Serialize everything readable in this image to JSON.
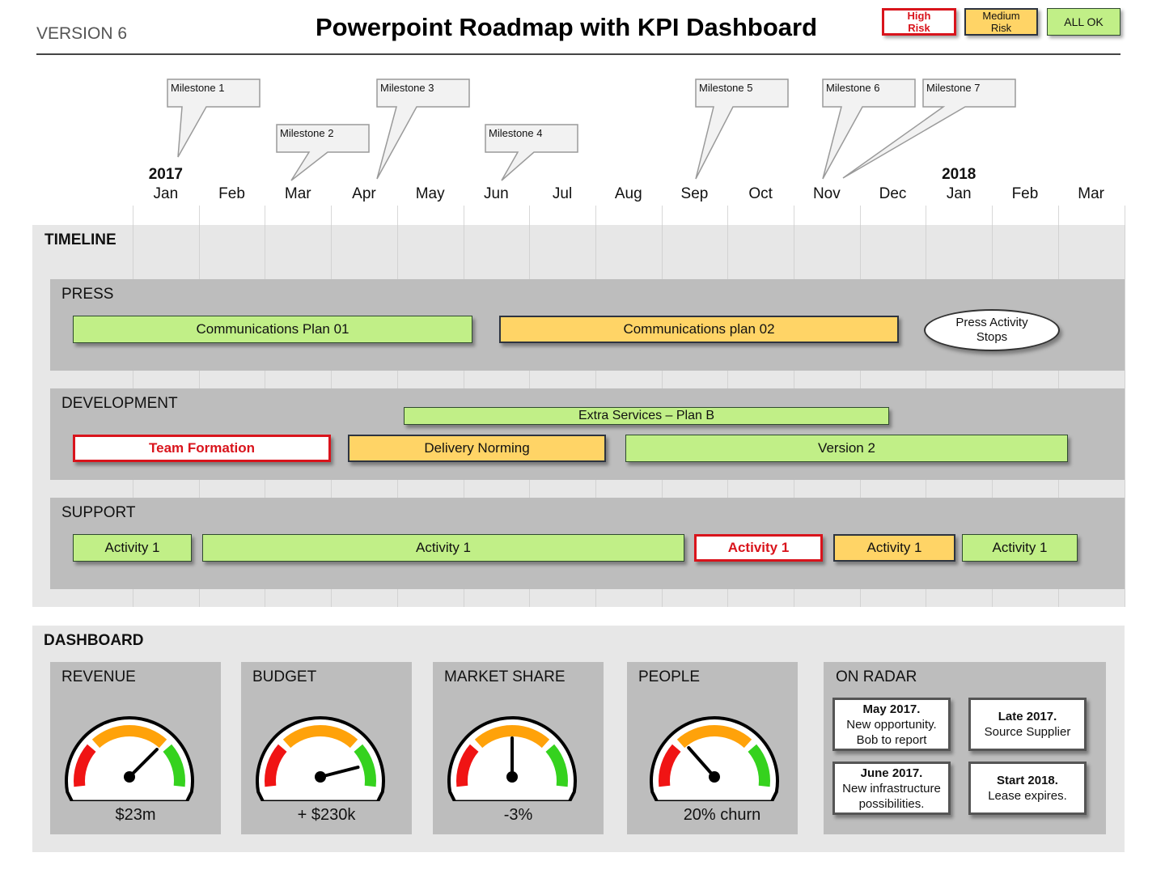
{
  "header": {
    "version": "VERSION 6",
    "title": "Powerpoint Roadmap with KPI Dashboard",
    "legend": [
      {
        "label": "High Risk",
        "status": "high",
        "color": "#d9141c"
      },
      {
        "label": "Medium Risk",
        "status": "medium",
        "color": "#ffd466"
      },
      {
        "label": "ALL OK",
        "status": "ok",
        "color": "#c1ef87"
      }
    ]
  },
  "axis": {
    "years": [
      {
        "label": "2017",
        "month_index": 0
      },
      {
        "label": "2018",
        "month_index": 12
      }
    ],
    "months": [
      "Jan",
      "Feb",
      "Mar",
      "Apr",
      "May",
      "Jun",
      "Jul",
      "Aug",
      "Sep",
      "Oct",
      "Nov",
      "Dec",
      "Jan",
      "Feb",
      "Mar"
    ]
  },
  "milestones": [
    {
      "label": "Milestone  1",
      "month_index": 0.2
    },
    {
      "label": "Milestone  2",
      "month_index": 1.9
    },
    {
      "label": "Milestone  3",
      "month_index": 3.2
    },
    {
      "label": "Milestone  4",
      "month_index": 5.1
    },
    {
      "label": "Milestone  5",
      "month_index": 8.0
    },
    {
      "label": "Milestone  6",
      "month_index": 9.95
    },
    {
      "label": "Milestone  7",
      "month_index": 10.3
    }
  ],
  "timeline": {
    "title": "TIMELINE",
    "lanes": [
      {
        "name": "PRESS",
        "items": [
          {
            "label": "Communications  Plan 01",
            "status": "ok",
            "start": -0.9,
            "end": 5.15
          },
          {
            "label": "Communications  plan 02",
            "status": "medium",
            "start": 5.55,
            "end": 11.6
          },
          {
            "label": "Press Activity Stops",
            "status": "note",
            "shape": "ellipse"
          }
        ]
      },
      {
        "name": "DEVELOPMENT",
        "items": [
          {
            "label": "Extra Services – Plan B",
            "status": "ok",
            "start": 4.1,
            "end": 11.45
          },
          {
            "label": "Team Formation",
            "status": "high",
            "start": -0.9,
            "end": 3.0
          },
          {
            "label": "Delivery Norming",
            "status": "medium",
            "start": 3.25,
            "end": 7.15
          },
          {
            "label": "Version 2",
            "status": "ok",
            "start": 7.45,
            "end": 14.15
          }
        ]
      },
      {
        "name": "SUPPORT",
        "items": [
          {
            "label": "Activity 1",
            "status": "ok",
            "start": -0.9,
            "end": 0.9
          },
          {
            "label": "Activity 1",
            "status": "ok",
            "start": 1.05,
            "end": 8.35
          },
          {
            "label": "Activity 1",
            "status": "high",
            "start": 8.5,
            "end": 10.45
          },
          {
            "label": "Activity 1",
            "status": "medium",
            "start": 10.6,
            "end": 12.45
          },
          {
            "label": "Activity 1",
            "status": "ok",
            "start": 12.55,
            "end": 14.3
          }
        ]
      }
    ]
  },
  "dashboard": {
    "title": "DASHBOARD",
    "kpis": [
      {
        "title": "REVENUE",
        "value": "$23m",
        "needle": 0.75
      },
      {
        "title": "BUDGET",
        "value": "+ $230k",
        "needle": 0.92
      },
      {
        "title": "MARKET SHARE",
        "value": "-3%",
        "needle": 0.5
      },
      {
        "title": "PEOPLE",
        "value": "20% churn",
        "needle": 0.27
      }
    ],
    "radar": {
      "title": "ON RADAR",
      "cards": [
        {
          "heading": "May 2017.",
          "lines": [
            "New opportunity.",
            "Bob to report"
          ]
        },
        {
          "heading": "Late 2017.",
          "lines": [
            "Source Supplier"
          ]
        },
        {
          "heading": "June 2017.",
          "lines": [
            "New infrastructure",
            "possibilities."
          ]
        },
        {
          "heading": "Start 2018.",
          "lines": [
            "Lease expires."
          ]
        }
      ]
    }
  },
  "colors": {
    "high": "#d9141c",
    "medium": "#ffd466",
    "ok": "#c1ef87",
    "gauge_red": "#f01414",
    "gauge_orange": "#ffa20a",
    "gauge_green": "#35d21e"
  }
}
